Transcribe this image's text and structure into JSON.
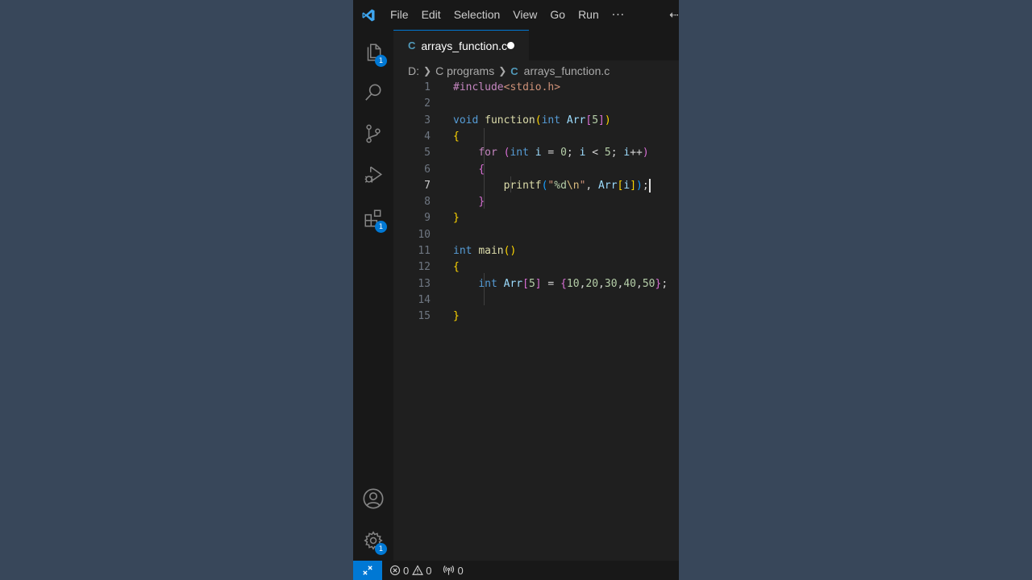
{
  "menu": {
    "items": [
      "File",
      "Edit",
      "Selection",
      "View",
      "Go",
      "Run"
    ],
    "more": "···",
    "edge_glyph": "⇠"
  },
  "activity": {
    "explorer_badge": "1",
    "extensions_badge": "1",
    "settings_badge": "1"
  },
  "tab": {
    "lang_icon": "C",
    "name": "arrays_function.c",
    "modified": true
  },
  "breadcrumb": {
    "drive": "D:",
    "folder": "C programs",
    "lang_icon": "C",
    "file": "arrays_function.c"
  },
  "editor": {
    "current_line": 7,
    "lines": [
      {
        "n": "1",
        "tokens": [
          {
            "c": "pre",
            "t": "#include"
          },
          {
            "c": "inc",
            "t": "<stdio.h>"
          }
        ]
      },
      {
        "n": "2",
        "tokens": []
      },
      {
        "n": "3",
        "tokens": [
          {
            "c": "kw",
            "t": "void"
          },
          {
            "c": "txt",
            "t": " "
          },
          {
            "c": "fn",
            "t": "function"
          },
          {
            "c": "b1",
            "t": "("
          },
          {
            "c": "kw",
            "t": "int"
          },
          {
            "c": "txt",
            "t": " "
          },
          {
            "c": "var",
            "t": "Arr"
          },
          {
            "c": "b2",
            "t": "["
          },
          {
            "c": "num",
            "t": "5"
          },
          {
            "c": "b2",
            "t": "]"
          },
          {
            "c": "b1",
            "t": ")"
          }
        ]
      },
      {
        "n": "4",
        "tokens": [
          {
            "c": "b1",
            "t": "{"
          }
        ]
      },
      {
        "n": "5",
        "tokens": [
          {
            "c": "txt",
            "t": "    "
          },
          {
            "c": "ctl",
            "t": "for"
          },
          {
            "c": "txt",
            "t": " "
          },
          {
            "c": "b2",
            "t": "("
          },
          {
            "c": "kw",
            "t": "int"
          },
          {
            "c": "txt",
            "t": " "
          },
          {
            "c": "var",
            "t": "i"
          },
          {
            "c": "txt",
            "t": " = "
          },
          {
            "c": "num",
            "t": "0"
          },
          {
            "c": "txt",
            "t": "; "
          },
          {
            "c": "var",
            "t": "i"
          },
          {
            "c": "txt",
            "t": " < "
          },
          {
            "c": "num",
            "t": "5"
          },
          {
            "c": "txt",
            "t": "; "
          },
          {
            "c": "var",
            "t": "i"
          },
          {
            "c": "txt",
            "t": "++"
          },
          {
            "c": "b2",
            "t": ")"
          }
        ]
      },
      {
        "n": "6",
        "tokens": [
          {
            "c": "txt",
            "t": "    "
          },
          {
            "c": "b2",
            "t": "{"
          }
        ]
      },
      {
        "n": "7",
        "tokens": [
          {
            "c": "txt",
            "t": "        "
          },
          {
            "c": "fn",
            "t": "printf"
          },
          {
            "c": "b3",
            "t": "("
          },
          {
            "c": "str",
            "t": "\""
          },
          {
            "c": "num",
            "t": "%d"
          },
          {
            "c": "esc",
            "t": "\\n"
          },
          {
            "c": "str",
            "t": "\""
          },
          {
            "c": "txt",
            "t": ", "
          },
          {
            "c": "var",
            "t": "Arr"
          },
          {
            "c": "b1",
            "t": "["
          },
          {
            "c": "var",
            "t": "i"
          },
          {
            "c": "b1",
            "t": "]"
          },
          {
            "c": "b3",
            "t": ")"
          },
          {
            "c": "txt",
            "t": ";"
          }
        ]
      },
      {
        "n": "8",
        "tokens": [
          {
            "c": "txt",
            "t": "    "
          },
          {
            "c": "b2",
            "t": "}"
          }
        ]
      },
      {
        "n": "9",
        "tokens": [
          {
            "c": "b1",
            "t": "}"
          }
        ]
      },
      {
        "n": "10",
        "tokens": []
      },
      {
        "n": "11",
        "tokens": [
          {
            "c": "kw",
            "t": "int"
          },
          {
            "c": "txt",
            "t": " "
          },
          {
            "c": "fn",
            "t": "main"
          },
          {
            "c": "b1",
            "t": "()"
          }
        ]
      },
      {
        "n": "12",
        "tokens": [
          {
            "c": "b1",
            "t": "{"
          }
        ]
      },
      {
        "n": "13",
        "tokens": [
          {
            "c": "txt",
            "t": "    "
          },
          {
            "c": "kw",
            "t": "int"
          },
          {
            "c": "txt",
            "t": " "
          },
          {
            "c": "var",
            "t": "Arr"
          },
          {
            "c": "b2",
            "t": "["
          },
          {
            "c": "num",
            "t": "5"
          },
          {
            "c": "b2",
            "t": "]"
          },
          {
            "c": "txt",
            "t": " = "
          },
          {
            "c": "b2",
            "t": "{"
          },
          {
            "c": "num",
            "t": "10"
          },
          {
            "c": "txt",
            "t": ","
          },
          {
            "c": "num",
            "t": "20"
          },
          {
            "c": "txt",
            "t": ","
          },
          {
            "c": "num",
            "t": "30"
          },
          {
            "c": "txt",
            "t": ","
          },
          {
            "c": "num",
            "t": "40"
          },
          {
            "c": "txt",
            "t": ","
          },
          {
            "c": "num",
            "t": "50"
          },
          {
            "c": "b2",
            "t": "}"
          },
          {
            "c": "txt",
            "t": ";"
          }
        ]
      },
      {
        "n": "14",
        "tokens": []
      },
      {
        "n": "15",
        "tokens": [
          {
            "c": "b1",
            "t": "}"
          }
        ]
      }
    ]
  },
  "status": {
    "errors": "0",
    "warnings": "0",
    "ports": "0"
  },
  "colors": {
    "accent": "#0078d4",
    "background": "#38475a",
    "editor_bg": "#1f1f1f"
  }
}
